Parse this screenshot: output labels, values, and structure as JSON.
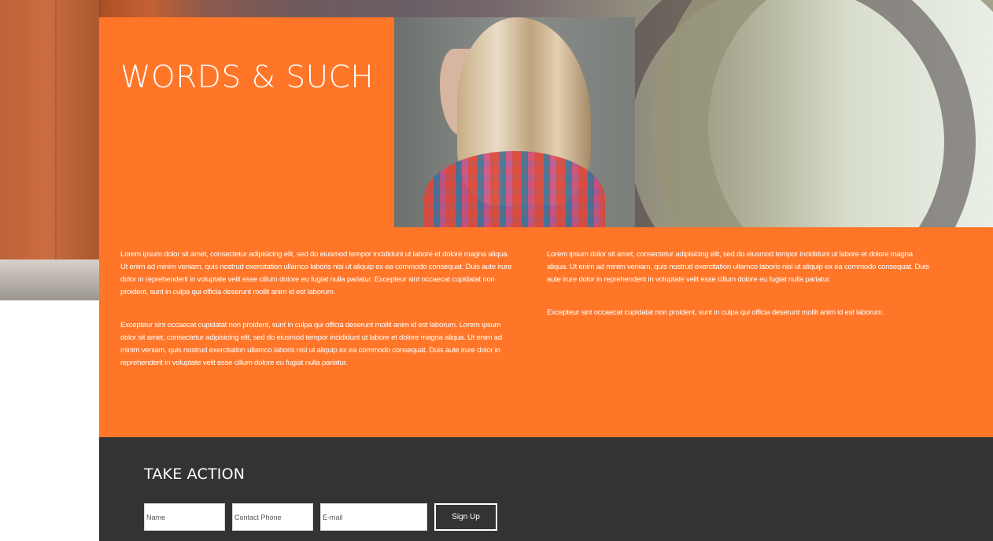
{
  "hero": {
    "title": "WORDS & SUCH"
  },
  "content": {
    "left_paragraphs": [
      "Lorem ipsum dolor sit amet, consectetur adipisicing elit, sed do eiusmod tempor incididunt ut labore et dolore magna aliqua. Ut enim ad minim veniam, quis nostrud exercitation ullamco laboris nisi ut aliquip ex ea commodo consequat. Duis aute irure dolor in reprehenderit in voluptate velit esse cillum dolore eu fugiat nulla pariatur. Excepteur sint occaecat cupidatat non proident, sunt in culpa qui officia deserunt mollit anim id est laborum.",
      "Excepteur sint occaecat cupidatat non proident, sunt in culpa qui officia deserunt mollit anim id est laborum. Lorem ipsum dolor sit amet, consectetur adipisicing elit, sed do eiusmod tempor incididunt ut labore et dolore magna aliqua. Ut enim ad minim veniam, quis nostrud exercitation ullamco laboris nisi ut aliquip ex ea commodo consequat. Duis aute irure dolor in reprehenderit in voluptate velit esse cillum dolore eu fugiat nulla pariatur."
    ],
    "right_paragraphs": [
      "Lorem ipsum dolor sit amet, consectetur adipisicing elit, sed do eiusmod tempor incididunt ut labore et dolore magna aliqua. Ut enim ad minim veniam, quis nostrud exercitation ullamco laboris nisi ut aliquip ex ea commodo consequat. Duis aute irure dolor in reprehenderit in voluptate velit esse cillum dolore eu fugiat nulla pariatur.",
      "Excepteur sint occaecat cupidatat non proident, sunt in culpa qui officia deserunt mollit anim id est laborum."
    ]
  },
  "action": {
    "title": "TAKE ACTION",
    "name_placeholder": "Name",
    "phone_placeholder": "Contact Phone",
    "email_placeholder": "E-mail",
    "signup_label": "Sign Up"
  },
  "colors": {
    "accent": "#ff7628",
    "footer": "#333333",
    "text_light": "#ffffff"
  }
}
